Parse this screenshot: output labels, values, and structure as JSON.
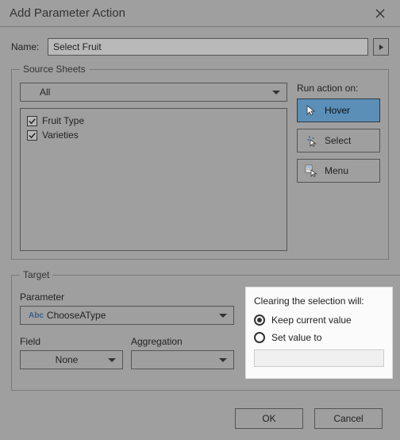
{
  "dialog": {
    "title": "Add Parameter Action"
  },
  "name": {
    "label": "Name:",
    "value": "Select Fruit"
  },
  "source": {
    "legend": "Source Sheets",
    "sheets_dropdown": "All",
    "items": [
      "Fruit Type",
      "Varieties"
    ],
    "run_label": "Run action on:",
    "hover": "Hover",
    "select": "Select",
    "menu": "Menu"
  },
  "target": {
    "legend": "Target",
    "parameter_label": "Parameter",
    "parameter_value": "ChooseAType",
    "field_label": "Field",
    "field_value": "None",
    "aggregation_label": "Aggregation",
    "aggregation_value": ""
  },
  "clearing": {
    "heading": "Clearing the selection will:",
    "keep": "Keep current value",
    "setto": "Set value to",
    "setto_value": ""
  },
  "buttons": {
    "ok": "OK",
    "cancel": "Cancel"
  }
}
